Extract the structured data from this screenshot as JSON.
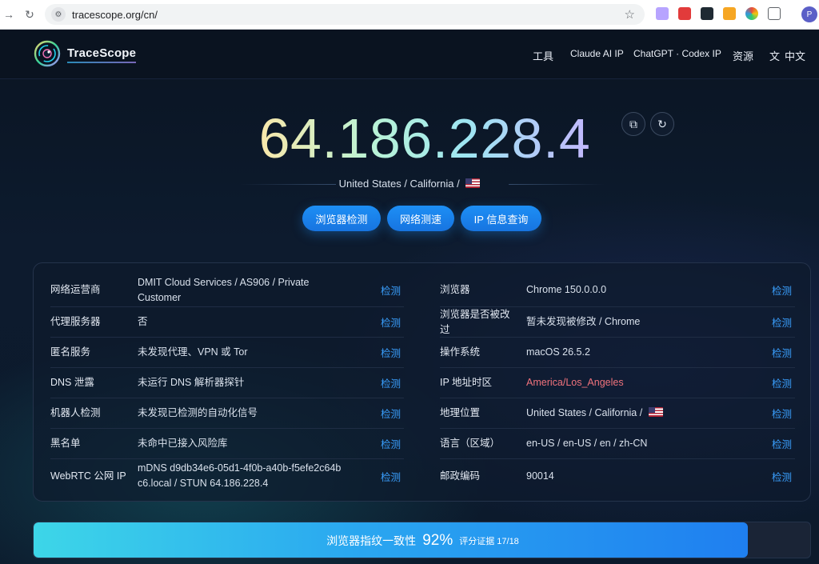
{
  "browser": {
    "url": "tracescope.org/cn/"
  },
  "header": {
    "brand": "TraceScope",
    "nav": {
      "tools": "工具",
      "claude": "Claude AI IP",
      "chatgpt": "ChatGPT · Codex IP",
      "resources": "资源",
      "language": "中文"
    }
  },
  "hero": {
    "ip": "64.186.228.4",
    "location": "United States / California /",
    "buttons": {
      "browser_check": "浏览器检测",
      "speed_test": "网络测速",
      "ip_lookup": "IP 信息查询"
    }
  },
  "left_rows": [
    {
      "key": "网络运营商",
      "value": "DMIT Cloud Services / AS906 / Private Customer",
      "action": "检测"
    },
    {
      "key": "代理服务器",
      "value": "否",
      "action": "检测"
    },
    {
      "key": "匿名服务",
      "value": "未发现代理、VPN 或 Tor",
      "action": "检测"
    },
    {
      "key": "DNS 泄露",
      "value": "未运行 DNS 解析器探针",
      "action": "检测"
    },
    {
      "key": "机器人检测",
      "value": "未发现已检测的自动化信号",
      "action": "检测"
    },
    {
      "key": "黑名单",
      "value": "未命中已接入风险库",
      "action": "检测"
    },
    {
      "key": "WebRTC 公网 IP",
      "value": "mDNS d9db34e6-05d1-4f0b-a40b-f5efe2c64bc6.local / STUN 64.186.228.4",
      "action": "检测"
    }
  ],
  "right_rows": [
    {
      "key": "浏览器",
      "value": "Chrome 150.0.0.0",
      "action": "检测"
    },
    {
      "key": "浏览器是否被改过",
      "value": "暂未发现被修改 / Chrome",
      "action": "检测"
    },
    {
      "key": "操作系统",
      "value": "macOS 26.5.2",
      "action": "检测"
    },
    {
      "key": "IP 地址时区",
      "value": "America/Los_Angeles",
      "action": "检测"
    },
    {
      "key": "地理位置",
      "value": "United States / California /",
      "action": "检测"
    },
    {
      "key": "语言（区域）",
      "value": "en-US / en-US / en / zh-CN",
      "action": "检测"
    },
    {
      "key": "邮政编码",
      "value": "90014",
      "action": "检测"
    }
  ],
  "consistency": {
    "label": "浏览器指纹一致性",
    "percent": "92%",
    "fraction": 0.92,
    "sub": "评分证据 17/18"
  },
  "colors": {
    "accent": "#1d8ff5",
    "link": "#3aa0ff",
    "alert": "#f0727c"
  }
}
